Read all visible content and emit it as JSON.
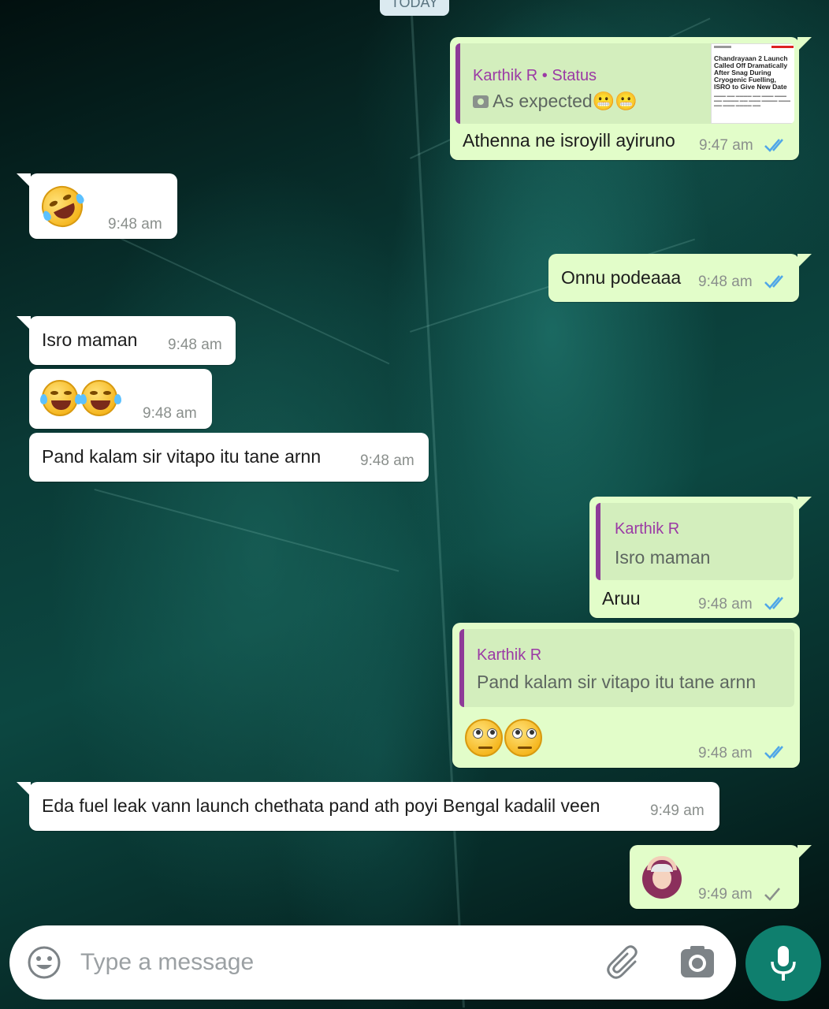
{
  "header": {
    "date_chip": "TODAY"
  },
  "messages": [
    {
      "id": "m1",
      "side": "out",
      "quote": {
        "name": "Karthik R • Status",
        "text": "As expected😬😬"
      },
      "thumbnail": {
        "headline": "Chandrayaan 2 Launch Called Off Dramatically After Snag During Cryogenic Fuelling, ISRO to Give New Date"
      },
      "text": "Athenna ne isroyill ayiruno",
      "time": "9:47 am",
      "status": "read"
    },
    {
      "id": "m2",
      "side": "in",
      "emoji": "rolling-on-floor-laughing",
      "time": "9:48 am"
    },
    {
      "id": "m3",
      "side": "out",
      "text": "Onnu podeaaa",
      "time": "9:48 am",
      "status": "read"
    },
    {
      "id": "m4",
      "side": "in",
      "text": "Isro maman",
      "time": "9:48 am"
    },
    {
      "id": "m5",
      "side": "in",
      "emoji": "face-with-tears-of-joy x2",
      "time": "9:48 am"
    },
    {
      "id": "m6",
      "side": "in",
      "text": "Pand kalam sir vitapo itu tane arnn",
      "time": "9:48 am"
    },
    {
      "id": "m7",
      "side": "out",
      "quote": {
        "name": "Karthik R",
        "text": "Isro maman"
      },
      "text": "Aruu",
      "time": "9:48 am",
      "status": "read"
    },
    {
      "id": "m8",
      "side": "out",
      "quote": {
        "name": "Karthik R",
        "text": "Pand kalam sir vitapo itu tane arnn"
      },
      "emoji": "face-with-rolling-eyes x2",
      "time": "9:48 am",
      "status": "read"
    },
    {
      "id": "m9",
      "side": "in",
      "text": "Eda fuel leak vann launch chethata pand ath poyi Bengal kadalil veen",
      "time": "9:49 am"
    },
    {
      "id": "m10",
      "side": "out",
      "emoji": "person-gesturing-ok",
      "time": "9:49 am",
      "status": "sent"
    }
  ],
  "composer": {
    "placeholder": "Type a message",
    "emoji_icon": "smiley-icon",
    "attach_icon": "paperclip-icon",
    "camera_icon": "camera-icon",
    "mic_icon": "microphone-icon"
  },
  "colors": {
    "incoming_bubble": "#ffffff",
    "outgoing_bubble": "#e2fdc9",
    "quote_accent": "#8e3b98",
    "read_ticks": "#4fa6e8",
    "mic_button": "#0f7f6e"
  }
}
